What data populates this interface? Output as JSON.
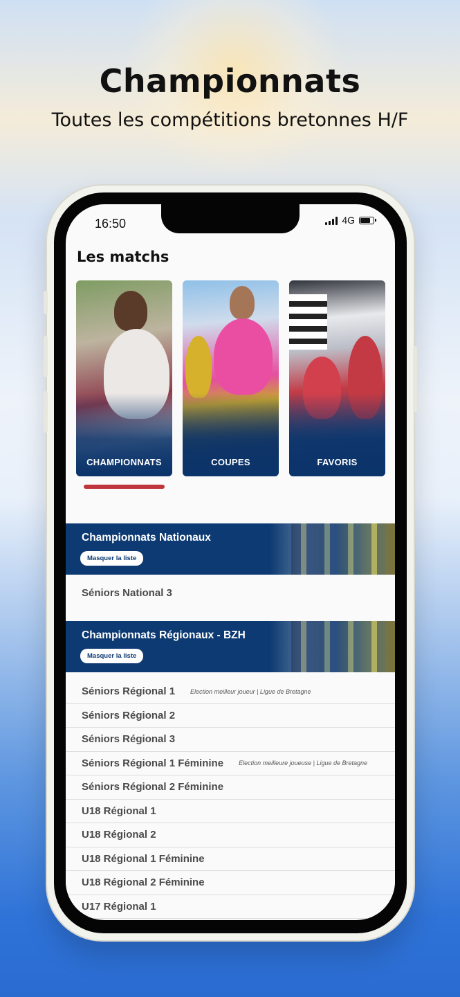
{
  "promo": {
    "headline": "Championnats",
    "subheadline": "Toutes les compétitions bretonnes H/F"
  },
  "status_bar": {
    "time": "16:50",
    "network": "4G"
  },
  "page": {
    "title": "Les matchs"
  },
  "category_cards": [
    {
      "label": "CHAMPIONNATS",
      "active": true
    },
    {
      "label": "COUPES",
      "active": false
    },
    {
      "label": "FAVORIS",
      "active": false
    }
  ],
  "sections": [
    {
      "title": "Championnats Nationaux",
      "button_label": "Masquer la liste",
      "items": [
        {
          "name": "Séniors National 3",
          "note": ""
        }
      ]
    },
    {
      "title": "Championnats Régionaux - BZH",
      "button_label": "Masquer la liste",
      "items": [
        {
          "name": "Séniors Régional 1",
          "note": "Election meilleur joueur | Ligue de Bretagne"
        },
        {
          "name": "Séniors Régional 2",
          "note": ""
        },
        {
          "name": "Séniors Régional 3",
          "note": ""
        },
        {
          "name": "Séniors Régional 1 Féminine",
          "note": "Election meilleure joueuse | Ligue de Bretagne"
        },
        {
          "name": "Séniors Régional 2 Féminine",
          "note": ""
        },
        {
          "name": "U18 Régional 1",
          "note": ""
        },
        {
          "name": "U18 Régional 2",
          "note": ""
        },
        {
          "name": "U18 Régional 1 Féminine",
          "note": ""
        },
        {
          "name": "U18 Régional 2 Féminine",
          "note": ""
        },
        {
          "name": "U17 Régional 1",
          "note": ""
        }
      ]
    }
  ],
  "colors": {
    "navy": "#0d3a72",
    "active_indicator": "#c0343b",
    "background_blue": "#2f73d8"
  }
}
